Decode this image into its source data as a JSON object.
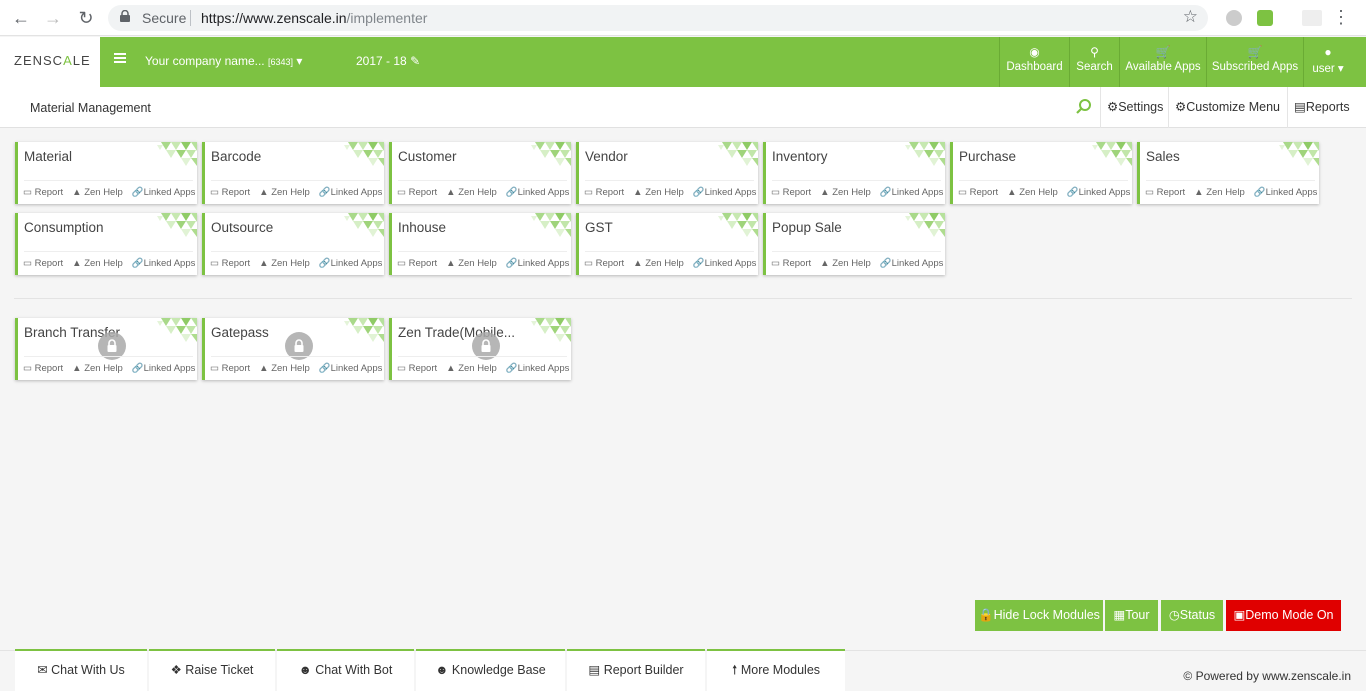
{
  "browser": {
    "secure_label": "Secure",
    "url_base": "https://www.zenscale.in",
    "url_path": "/implementer"
  },
  "header": {
    "logo_left": "ZENSC",
    "logo_mid": "A",
    "logo_right": "LE",
    "company": "Your company name...",
    "company_id": "[6343]",
    "year": "2017 - 18",
    "nav": {
      "dashboard": "Dashboard",
      "search": "Search",
      "available_apps": "Available Apps",
      "subscribed_apps": "Subscribed Apps",
      "user": "user"
    }
  },
  "subheader": {
    "title": "Material Management",
    "settings": "Settings",
    "customize_menu": "Customize Menu",
    "reports": "Reports"
  },
  "card_links": {
    "report": "Report",
    "zen_help": "Zen Help",
    "linked_apps": "Linked Apps"
  },
  "modules": [
    {
      "title": "Material"
    },
    {
      "title": "Barcode"
    },
    {
      "title": "Customer"
    },
    {
      "title": "Vendor"
    },
    {
      "title": "Inventory"
    },
    {
      "title": "Purchase"
    },
    {
      "title": "Sales"
    },
    {
      "title": "Consumption"
    },
    {
      "title": "Outsource"
    },
    {
      "title": "Inhouse"
    },
    {
      "title": "GST"
    },
    {
      "title": "Popup Sale"
    }
  ],
  "locked_modules": [
    {
      "title": "Branch Transfer"
    },
    {
      "title": "Gatepass"
    },
    {
      "title": "Zen Trade(Mobile..."
    }
  ],
  "actions": {
    "hide_lock": "Hide Lock Modules",
    "tour": "Tour",
    "status": "Status",
    "demo_mode": "Demo Mode On"
  },
  "footer": {
    "chat_with_us": "Chat With Us",
    "raise_ticket": "Raise Ticket",
    "chat_with_bot": "Chat With Bot",
    "knowledge_base": "Knowledge Base",
    "report_builder": "Report Builder",
    "more_modules": "More Modules",
    "powered_by": "© Powered by www.zenscale.in"
  },
  "colors": {
    "brand_green": "#7dc242",
    "demo_red": "#e00000"
  }
}
